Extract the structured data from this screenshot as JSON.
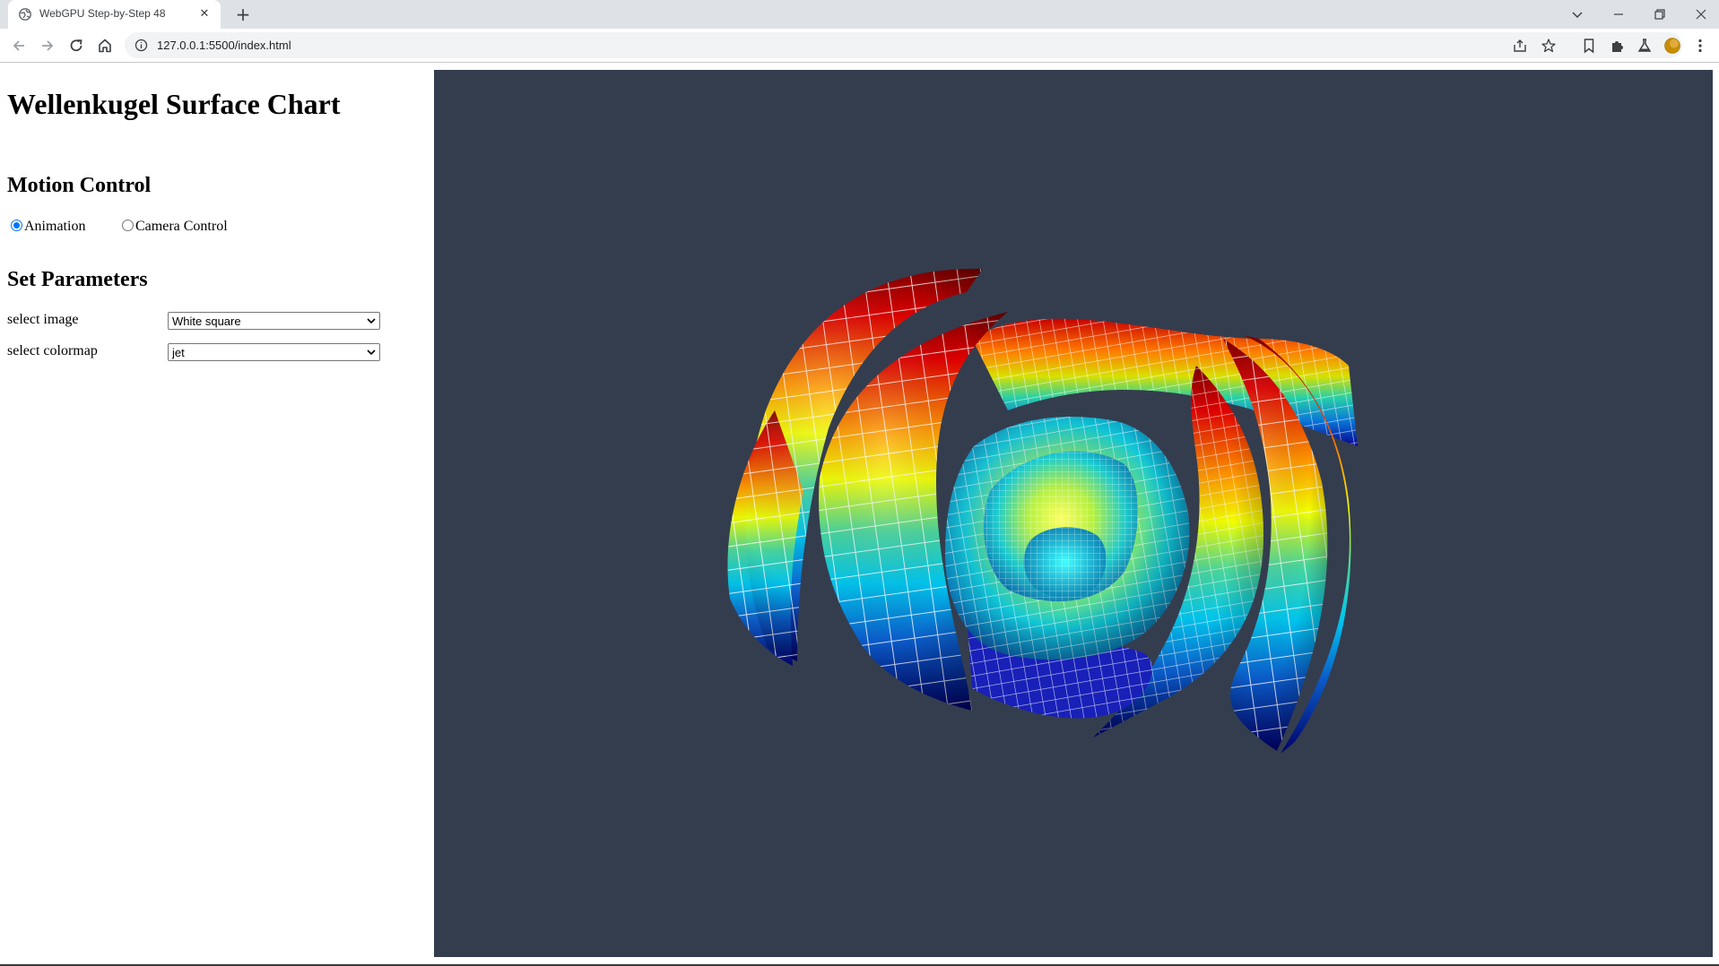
{
  "browser": {
    "tab_title": "WebGPU Step-by-Step 48",
    "url": "127.0.0.1:5500/index.html"
  },
  "page": {
    "title": "Wellenkugel Surface Chart",
    "motion_control": {
      "heading": "Motion Control",
      "options": [
        {
          "label": "Animation",
          "checked": true
        },
        {
          "label": "Camera Control",
          "checked": false
        }
      ]
    },
    "set_parameters": {
      "heading": "Set Parameters",
      "image_label": "select image",
      "image_value": "White square",
      "colormap_label": "select colormap",
      "colormap_value": "jet"
    }
  },
  "colors": {
    "canvas_bg": "#343d4e",
    "radio_accent": "#0075ff"
  },
  "icons": [
    "globe-favicon",
    "close-icon",
    "plus-icon",
    "chevron-down-icon",
    "minimize-icon",
    "restore-icon",
    "window-close-icon",
    "back-arrow-icon",
    "forward-arrow-icon",
    "reload-icon",
    "home-icon",
    "info-icon",
    "share-icon",
    "star-icon",
    "bookmark-icon",
    "puzzle-icon",
    "flask-icon",
    "profile-icon",
    "kebab-menu-icon"
  ]
}
